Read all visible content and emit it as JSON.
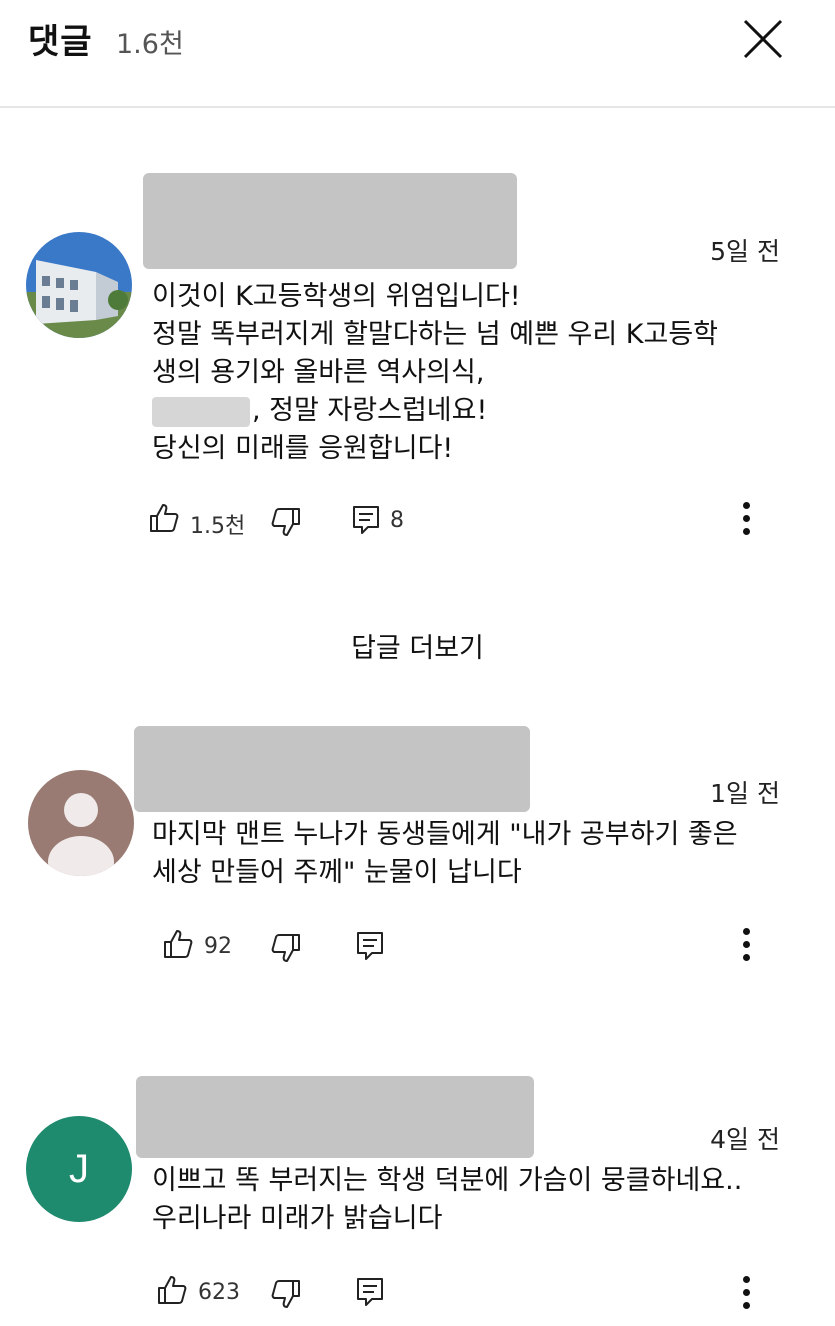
{
  "header": {
    "title": "댓글",
    "count": "1.6천"
  },
  "comments": [
    {
      "time": "5일 전",
      "lines": [
        "이것이  K고등학생의 위엄입니다!",
        "정말 똑부러지게 할말다하는 넘 예쁜  우리 K고등학",
        "생의 용기와 올바른 역사의식,",
        ", 정말 자랑스럽네요!",
        "당신의 미래를 응원합니다!"
      ],
      "likes": "1.5천",
      "replies": "8"
    },
    {
      "time": "1일 전",
      "lines": [
        "마지막 맨트 누나가 동생들에게 \"내가 공부하기 좋은",
        "세상 만들어 주께\" 눈물이 납니다"
      ],
      "likes": "92"
    },
    {
      "time": "4일 전",
      "avatar_letter": "J",
      "lines": [
        "이쁘고 똑 부러지는 학생 덕분에 가슴이 뭉클하네요..",
        "우리나라 미래가 밝습니다"
      ],
      "likes": "623"
    }
  ],
  "more_replies": "답글 더보기",
  "colors": {
    "avatar_green": "#1e8a6e",
    "avatar_brown": "#9a7b73",
    "redaction": "#c4c4c4"
  }
}
